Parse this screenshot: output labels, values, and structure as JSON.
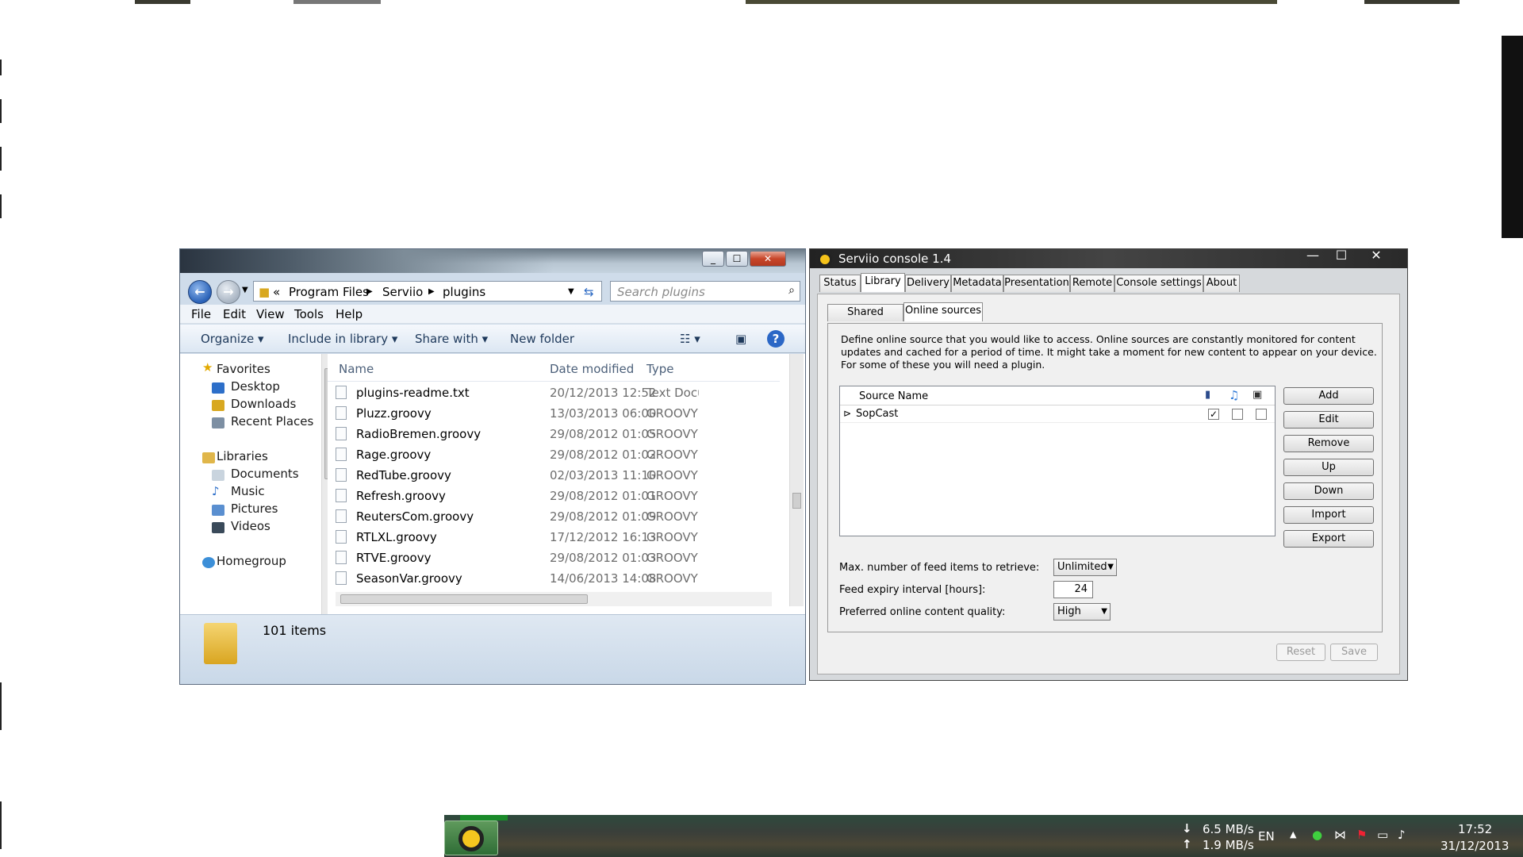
{
  "explorer": {
    "address": {
      "root_chevron": "«",
      "crumbs": [
        "Program Files",
        "Serviio",
        "plugins"
      ]
    },
    "search": {
      "placeholder": "Search plugins"
    },
    "menu": [
      "File",
      "Edit",
      "View",
      "Tools",
      "Help"
    ],
    "toolbar": {
      "organize": "Organize",
      "include_in_library": "Include in library",
      "share_with": "Share with",
      "new_folder": "New folder"
    },
    "nav": {
      "favorites": "Favorites",
      "favorite_items": [
        "Desktop",
        "Downloads",
        "Recent Places"
      ],
      "libraries": "Libraries",
      "library_items": [
        "Documents",
        "Music",
        "Pictures",
        "Videos"
      ],
      "homegroup": "Homegroup"
    },
    "columns": {
      "name": "Name",
      "date": "Date modified",
      "type": "Type"
    },
    "files": [
      {
        "name": "plugins-readme.txt",
        "date": "20/12/2013 12:52",
        "type": "Text Docu"
      },
      {
        "name": "Pluzz.groovy",
        "date": "13/03/2013 06:00",
        "type": "GROOVY I"
      },
      {
        "name": "RadioBremen.groovy",
        "date": "29/08/2012 01:05",
        "type": "GROOVY I"
      },
      {
        "name": "Rage.groovy",
        "date": "29/08/2012 01:02",
        "type": "GROOVY I"
      },
      {
        "name": "RedTube.groovy",
        "date": "02/03/2013 11:10",
        "type": "GROOVY I"
      },
      {
        "name": "Refresh.groovy",
        "date": "29/08/2012 01:01",
        "type": "GROOVY I"
      },
      {
        "name": "ReutersCom.groovy",
        "date": "29/08/2012 01:09",
        "type": "GROOVY I"
      },
      {
        "name": "RTLXL.groovy",
        "date": "17/12/2012 16:13",
        "type": "GROOVY I"
      },
      {
        "name": "RTVE.groovy",
        "date": "29/08/2012 01:03",
        "type": "GROOVY I"
      },
      {
        "name": "SeasonVar.groovy",
        "date": "14/06/2013 14:08",
        "type": "GROOVY I"
      }
    ],
    "status": {
      "count": "101 items"
    }
  },
  "serviio": {
    "title": "Serviio console 1.4",
    "tabs": [
      "Status",
      "Library",
      "Delivery",
      "Metadata",
      "Presentation",
      "Remote",
      "Console settings",
      "About"
    ],
    "active_tab": "Library",
    "subtabs": [
      "Shared folders",
      "Online sources"
    ],
    "active_subtab": "Online sources",
    "description": "Define online source that you would like to access. Online sources are constantly monitored for content updates and cached for a period of time. It might take a moment for new content to appear on your device. For some of these you will need a plugin.",
    "table": {
      "header": "Source Name",
      "rows": [
        {
          "name": "SopCast",
          "video": true,
          "audio": false,
          "image": false
        }
      ]
    },
    "buttons": [
      "Add",
      "Edit",
      "Remove",
      "Up",
      "Down",
      "Import",
      "Export"
    ],
    "settings": {
      "max_items_label": "Max. number of feed items to retrieve:",
      "max_items_value": "Unlimited",
      "expiry_label": "Feed expiry interval [hours]:",
      "expiry_value": "24",
      "quality_label": "Preferred online content quality:",
      "quality_value": "High"
    },
    "footer": {
      "reset": "Reset",
      "save": "Save"
    }
  },
  "taskbar": {
    "download_speed": "6.5 MB/s",
    "upload_speed": "1.9 MB/s",
    "language": "EN",
    "time": "17:52",
    "date": "31/12/2013"
  }
}
